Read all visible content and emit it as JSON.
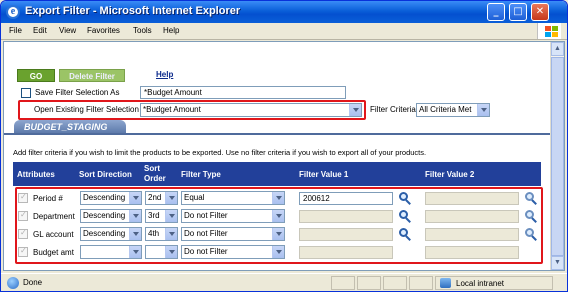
{
  "window": {
    "title": "Export Filter - Microsoft Internet Explorer",
    "buttons": {
      "minimize": "_",
      "maximize": "□",
      "close": "✕"
    }
  },
  "menu": [
    "File",
    "Edit",
    "View",
    "Favorites",
    "Tools",
    "Help"
  ],
  "toolbar": {
    "go_label": "GO",
    "delete_label": "Delete Filter",
    "help_label": "Help"
  },
  "filter": {
    "save_as_label": "Save Filter Selection As",
    "save_as_value": "*Budget Amount",
    "open_existing_label": "Open Existing Filter Selection",
    "open_existing_value": "*Budget Amount",
    "criteria_label": "Filter Criteria",
    "criteria_value": "All Criteria Met"
  },
  "tab": {
    "label": "BUDGET_STAGING"
  },
  "info_text": "Add filter criteria if you wish to limit the products to be exported. Use no filter criteria if you wish to export all of your products.",
  "table": {
    "headers": {
      "attributes": "Attributes",
      "sort_direction": "Sort Direction",
      "sort_order_1": "Sort",
      "sort_order_2": "Order",
      "filter_type": "Filter Type",
      "filter_value_1": "Filter Value 1",
      "filter_value_2": "Filter Value 2"
    },
    "rows": [
      {
        "attribute": "Period #",
        "sort_direction": "Descending",
        "sort_order": "2nd",
        "filter_type": "Equal",
        "value1": "200612",
        "value2": ""
      },
      {
        "attribute": "Department",
        "sort_direction": "Descending",
        "sort_order": "3rd",
        "filter_type": "Do not Filter",
        "value1": "",
        "value2": ""
      },
      {
        "attribute": "GL account",
        "sort_direction": "Descending",
        "sort_order": "4th",
        "filter_type": "Do not Filter",
        "value1": "",
        "value2": ""
      },
      {
        "attribute": "Budget amt",
        "sort_direction": "",
        "sort_order": "",
        "filter_type": "Do not Filter",
        "value1": "",
        "value2": ""
      }
    ]
  },
  "status": {
    "left": "Done",
    "zone": "Local intranet"
  },
  "colors": {
    "title_blue": "#0a5fd8",
    "header_blue": "#22409a",
    "highlight_red": "#e0161b",
    "go_green": "#6aa22e"
  }
}
